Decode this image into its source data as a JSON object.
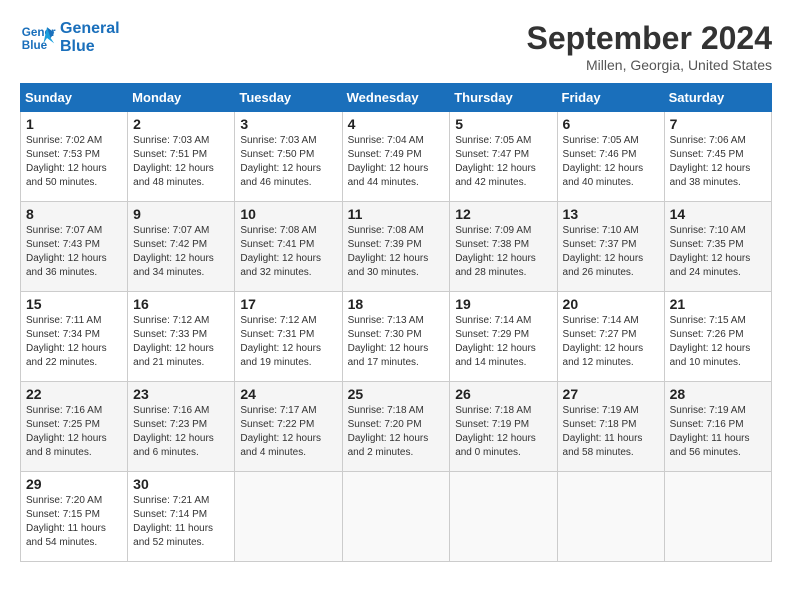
{
  "logo": {
    "line1": "General",
    "line2": "Blue"
  },
  "title": "September 2024",
  "subtitle": "Millen, Georgia, United States",
  "days_of_week": [
    "Sunday",
    "Monday",
    "Tuesday",
    "Wednesday",
    "Thursday",
    "Friday",
    "Saturday"
  ],
  "weeks": [
    [
      {
        "day": "1",
        "sunrise": "7:02 AM",
        "sunset": "7:53 PM",
        "daylight": "12 hours and 50 minutes."
      },
      {
        "day": "2",
        "sunrise": "7:03 AM",
        "sunset": "7:51 PM",
        "daylight": "12 hours and 48 minutes."
      },
      {
        "day": "3",
        "sunrise": "7:03 AM",
        "sunset": "7:50 PM",
        "daylight": "12 hours and 46 minutes."
      },
      {
        "day": "4",
        "sunrise": "7:04 AM",
        "sunset": "7:49 PM",
        "daylight": "12 hours and 44 minutes."
      },
      {
        "day": "5",
        "sunrise": "7:05 AM",
        "sunset": "7:47 PM",
        "daylight": "12 hours and 42 minutes."
      },
      {
        "day": "6",
        "sunrise": "7:05 AM",
        "sunset": "7:46 PM",
        "daylight": "12 hours and 40 minutes."
      },
      {
        "day": "7",
        "sunrise": "7:06 AM",
        "sunset": "7:45 PM",
        "daylight": "12 hours and 38 minutes."
      }
    ],
    [
      {
        "day": "8",
        "sunrise": "7:07 AM",
        "sunset": "7:43 PM",
        "daylight": "12 hours and 36 minutes."
      },
      {
        "day": "9",
        "sunrise": "7:07 AM",
        "sunset": "7:42 PM",
        "daylight": "12 hours and 34 minutes."
      },
      {
        "day": "10",
        "sunrise": "7:08 AM",
        "sunset": "7:41 PM",
        "daylight": "12 hours and 32 minutes."
      },
      {
        "day": "11",
        "sunrise": "7:08 AM",
        "sunset": "7:39 PM",
        "daylight": "12 hours and 30 minutes."
      },
      {
        "day": "12",
        "sunrise": "7:09 AM",
        "sunset": "7:38 PM",
        "daylight": "12 hours and 28 minutes."
      },
      {
        "day": "13",
        "sunrise": "7:10 AM",
        "sunset": "7:37 PM",
        "daylight": "12 hours and 26 minutes."
      },
      {
        "day": "14",
        "sunrise": "7:10 AM",
        "sunset": "7:35 PM",
        "daylight": "12 hours and 24 minutes."
      }
    ],
    [
      {
        "day": "15",
        "sunrise": "7:11 AM",
        "sunset": "7:34 PM",
        "daylight": "12 hours and 22 minutes."
      },
      {
        "day": "16",
        "sunrise": "7:12 AM",
        "sunset": "7:33 PM",
        "daylight": "12 hours and 21 minutes."
      },
      {
        "day": "17",
        "sunrise": "7:12 AM",
        "sunset": "7:31 PM",
        "daylight": "12 hours and 19 minutes."
      },
      {
        "day": "18",
        "sunrise": "7:13 AM",
        "sunset": "7:30 PM",
        "daylight": "12 hours and 17 minutes."
      },
      {
        "day": "19",
        "sunrise": "7:14 AM",
        "sunset": "7:29 PM",
        "daylight": "12 hours and 14 minutes."
      },
      {
        "day": "20",
        "sunrise": "7:14 AM",
        "sunset": "7:27 PM",
        "daylight": "12 hours and 12 minutes."
      },
      {
        "day": "21",
        "sunrise": "7:15 AM",
        "sunset": "7:26 PM",
        "daylight": "12 hours and 10 minutes."
      }
    ],
    [
      {
        "day": "22",
        "sunrise": "7:16 AM",
        "sunset": "7:25 PM",
        "daylight": "12 hours and 8 minutes."
      },
      {
        "day": "23",
        "sunrise": "7:16 AM",
        "sunset": "7:23 PM",
        "daylight": "12 hours and 6 minutes."
      },
      {
        "day": "24",
        "sunrise": "7:17 AM",
        "sunset": "7:22 PM",
        "daylight": "12 hours and 4 minutes."
      },
      {
        "day": "25",
        "sunrise": "7:18 AM",
        "sunset": "7:20 PM",
        "daylight": "12 hours and 2 minutes."
      },
      {
        "day": "26",
        "sunrise": "7:18 AM",
        "sunset": "7:19 PM",
        "daylight": "12 hours and 0 minutes."
      },
      {
        "day": "27",
        "sunrise": "7:19 AM",
        "sunset": "7:18 PM",
        "daylight": "11 hours and 58 minutes."
      },
      {
        "day": "28",
        "sunrise": "7:19 AM",
        "sunset": "7:16 PM",
        "daylight": "11 hours and 56 minutes."
      }
    ],
    [
      {
        "day": "29",
        "sunrise": "7:20 AM",
        "sunset": "7:15 PM",
        "daylight": "11 hours and 54 minutes."
      },
      {
        "day": "30",
        "sunrise": "7:21 AM",
        "sunset": "7:14 PM",
        "daylight": "11 hours and 52 minutes."
      },
      null,
      null,
      null,
      null,
      null
    ]
  ],
  "labels": {
    "sunrise": "Sunrise:",
    "sunset": "Sunset:",
    "daylight": "Daylight:"
  }
}
